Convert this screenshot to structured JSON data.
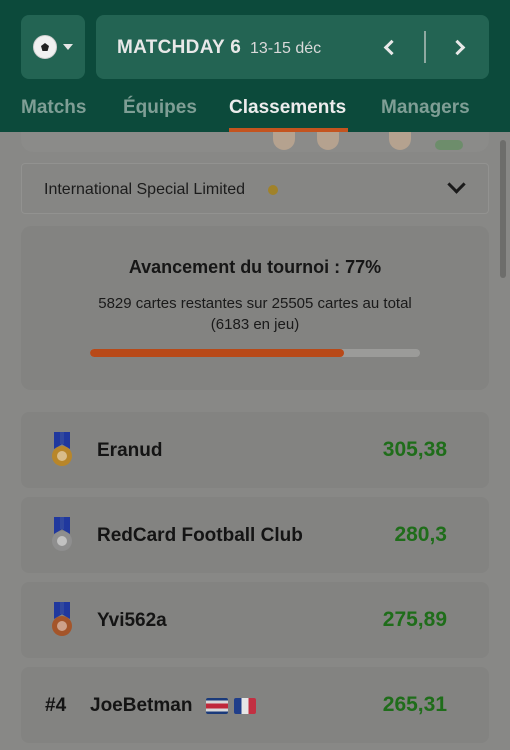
{
  "header": {
    "sport_icon": "soccer-ball-icon",
    "matchday_title": "MATCHDAY 6",
    "matchday_dates": "13-15 déc"
  },
  "tabs": [
    {
      "label": "Matchs",
      "active": false
    },
    {
      "label": "Équipes",
      "active": false
    },
    {
      "label": "Classements",
      "active": true
    },
    {
      "label": "Managers",
      "active": false
    }
  ],
  "league": {
    "name": "International Special Limited",
    "status_color": "#d4a72c"
  },
  "progress": {
    "title": "Avancement du tournoi : 77%",
    "line1": "5829 cartes restantes sur 25505 cartes au total",
    "line2": "(6183 en jeu)",
    "percent": 77
  },
  "rankings": [
    {
      "medal": "gold",
      "name": "Eranud",
      "score": "305,38"
    },
    {
      "medal": "silver",
      "name": "RedCard Football Club",
      "score": "280,3"
    },
    {
      "medal": "bronze",
      "name": "Yvi562a",
      "score": "275,89"
    },
    {
      "rank": "#4",
      "name": "JoeBetman",
      "flags": [
        "costa-rica-flag-icon",
        "france-flag-icon"
      ],
      "score": "265,31"
    }
  ],
  "colors": {
    "header_bg": "#0c4a3b",
    "accent": "#c4541f",
    "score_green": "#1f6d1a"
  }
}
